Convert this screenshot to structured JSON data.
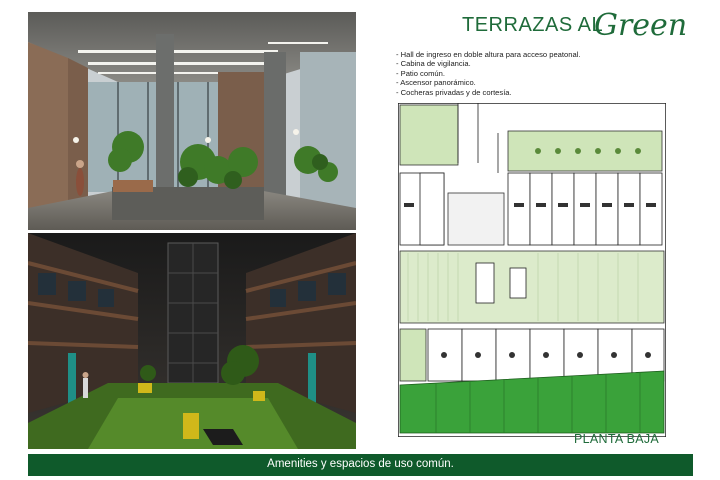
{
  "brand": {
    "name_main": "TERRAZAS AL",
    "name_script": "Green",
    "colors": {
      "brand_green": "#1f6b3a",
      "footer_green": "#0f5a2b",
      "lawn_green": "#7dbf55"
    }
  },
  "features": [
    "- Hall de ingreso en doble altura para acceso peatonal.",
    "- Cabina de vigilancia.",
    "- Patio común.",
    "- Ascensor panorámico.",
    "- Cocheras privadas y de cortesía."
  ],
  "plan": {
    "caption": "PLANTA BAJA"
  },
  "footer": {
    "text": "Amenities y espacios de uso común."
  },
  "renders": {
    "lobby_icon": "lobby-render-image",
    "atrium_icon": "atrium-render-image"
  }
}
